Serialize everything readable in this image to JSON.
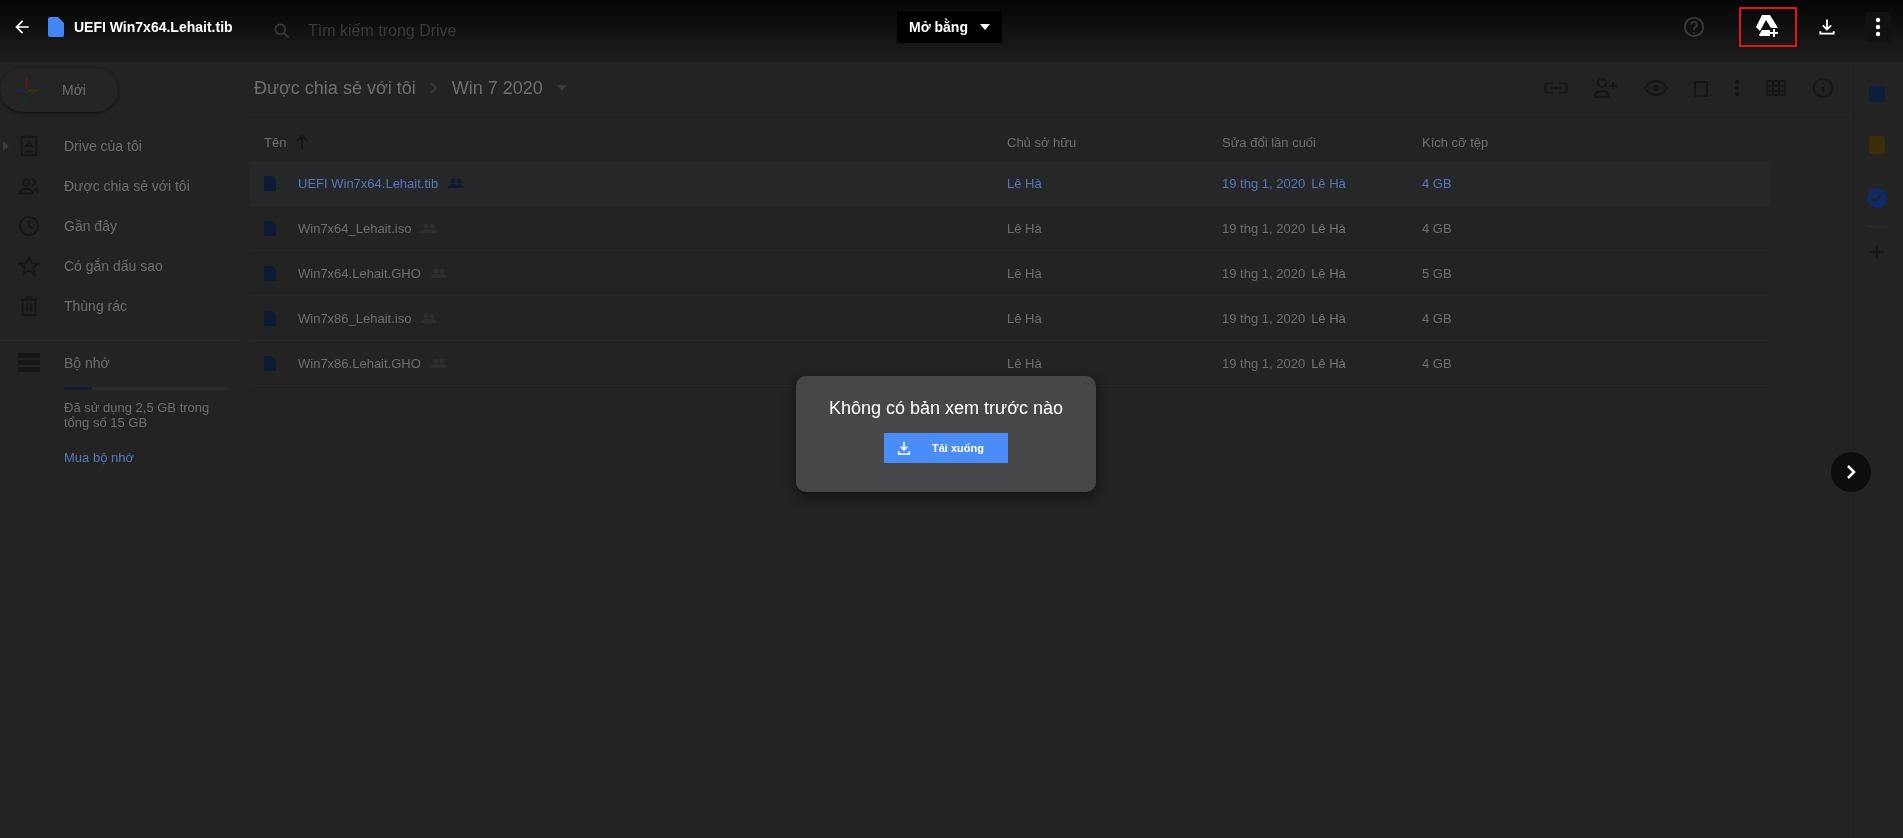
{
  "viewer_bar": {
    "file_name": "UEFI Win7x64.Lehait.tib",
    "search_placeholder": "Tìm kiếm trong Drive",
    "open_with": "Mở bằng"
  },
  "new_button": "Mới",
  "breadcrumb": [
    "Được chia sẻ với tôi",
    "Win 7 2020"
  ],
  "sidebar": {
    "items": [
      {
        "label": "Drive của tôi",
        "kind": "drive",
        "expandable": true
      },
      {
        "label": "Được chia sẻ với tôi",
        "kind": "shared",
        "expandable": false
      },
      {
        "label": "Gần đây",
        "kind": "recent",
        "expandable": false
      },
      {
        "label": "Có gắn dấu sao",
        "kind": "starred",
        "expandable": false
      },
      {
        "label": "Thùng rác",
        "kind": "trash",
        "expandable": false
      }
    ],
    "storage": {
      "label": "Bộ nhớ",
      "level": 0.17,
      "usage": "Đã sử dụng 2,5 GB trong tổng số 15 GB",
      "buy": "Mua bộ nhớ"
    }
  },
  "table": {
    "columns": [
      "Tên",
      "Chủ sở hữu",
      "Sửa đổi lần cuối",
      "Kích cỡ tệp"
    ],
    "rows": [
      {
        "name": "UEFI Win7x64.Lehait.tib",
        "owner": "Lê Hà",
        "modified": "19 thg 1, 2020",
        "modified_by": "Lê Hà",
        "size": "4 GB",
        "selected": true
      },
      {
        "name": "Win7x64_Lehait.iso",
        "owner": "Lê Hà",
        "modified": "19 thg 1, 2020",
        "modified_by": "Lê Hà",
        "size": "4 GB",
        "selected": false
      },
      {
        "name": "Win7x64.Lehait.GHO",
        "owner": "Lê Hà",
        "modified": "19 thg 1, 2020",
        "modified_by": "Lê Hà",
        "size": "5 GB",
        "selected": false
      },
      {
        "name": "Win7x86_Lehait.iso",
        "owner": "Lê Hà",
        "modified": "19 thg 1, 2020",
        "modified_by": "Lê Hà",
        "size": "4 GB",
        "selected": false
      },
      {
        "name": "Win7x86.Lehait.GHO",
        "owner": "Lê Hà",
        "modified": "19 thg 1, 2020",
        "modified_by": "Lê Hà",
        "size": "4 GB",
        "selected": false
      }
    ]
  },
  "preview": {
    "message": "Không có bản xem trước nào",
    "download": "Tải xuống"
  }
}
